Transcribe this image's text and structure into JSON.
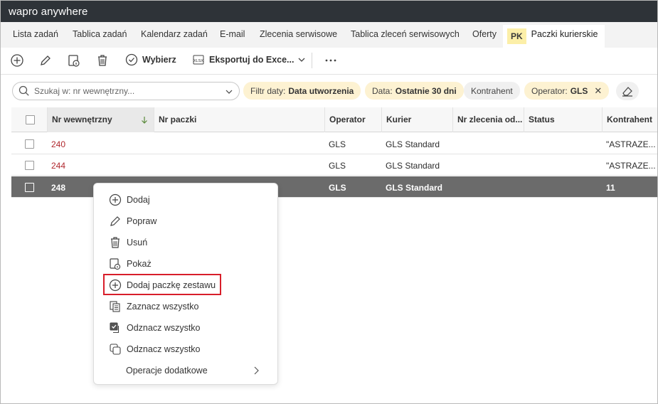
{
  "app": {
    "logo_text": "wapro anywhere"
  },
  "tabs": [
    {
      "label": "Lista zadań"
    },
    {
      "label": "Tablica zadań"
    },
    {
      "label": "Kalendarz zadań"
    },
    {
      "label": "E-mail"
    },
    {
      "label": "Zlecenia serwisowe"
    },
    {
      "label": "Tablica zleceń serwisowych"
    },
    {
      "label": "Oferty"
    }
  ],
  "active_tab": {
    "badge": "PK",
    "label": "Paczki kurierskie"
  },
  "toolbar": {
    "select_label": "Wybierz",
    "export_label": "Eksportuj do Exce...",
    "xlsx_text": "XLSX"
  },
  "filters": {
    "search_placeholder": "Szukaj w: nr wewnętrzny...",
    "chips": [
      {
        "label": "Filtr daty:",
        "value": "Data utworzenia"
      },
      {
        "label": "Data:",
        "value": "Ostatnie 30 dni"
      },
      {
        "label": "Kontrahent",
        "value": ""
      },
      {
        "label": "Operator:",
        "value": "GLS"
      }
    ]
  },
  "table": {
    "columns": [
      "Nr wewnętrzny",
      "Nr paczki",
      "Operator",
      "Kurier",
      "Nr zlecenia od...",
      "Status",
      "Kontrahent"
    ],
    "rows": [
      {
        "nr": "240",
        "paczka": "",
        "operator": "GLS",
        "kurier": "GLS Standard",
        "zlecenie": "",
        "status": "",
        "kontrahent": "\"ASTRAZE..."
      },
      {
        "nr": "244",
        "paczka": "",
        "operator": "GLS",
        "kurier": "GLS Standard",
        "zlecenie": "",
        "status": "",
        "kontrahent": "\"ASTRAZE..."
      },
      {
        "nr": "248",
        "paczka": "",
        "operator": "GLS",
        "kurier": "GLS Standard",
        "zlecenie": "",
        "status": "",
        "kontrahent": "11"
      }
    ]
  },
  "context_menu": {
    "items": [
      {
        "label": "Dodaj",
        "icon": "plus-circle-icon"
      },
      {
        "label": "Popraw",
        "icon": "pencil-icon"
      },
      {
        "label": "Usuń",
        "icon": "trash-icon"
      },
      {
        "label": "Pokaż",
        "icon": "document-info-icon"
      },
      {
        "label": "Dodaj paczkę zestawu",
        "icon": "plus-circle-icon"
      },
      {
        "label": "Zaznacz wszystko",
        "icon": "select-all-icon"
      },
      {
        "label": "Odznacz wszystko",
        "icon": "checked-square-icon"
      },
      {
        "label": "Odznacz wszystko",
        "icon": "copy-squares-icon"
      },
      {
        "label": "Operacje dodatkowe",
        "icon": "chevron-right-icon"
      }
    ]
  },
  "colors": {
    "titlebar": "#2e3338",
    "accent_yellow": "#fdf2d2",
    "link_red": "#b0282e",
    "selected_row": "#6b6b6b",
    "highlight_border": "#d81e2a"
  }
}
